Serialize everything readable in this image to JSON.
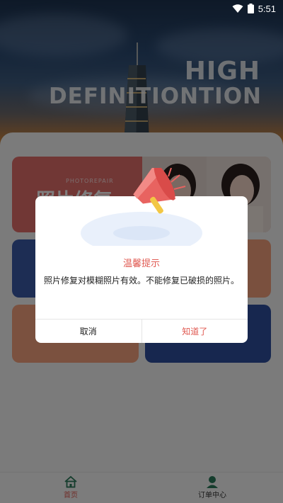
{
  "status_bar": {
    "time": "5:51",
    "icons": [
      "wifi-icon",
      "battery-icon"
    ]
  },
  "hero": {
    "title_line1": "HIGH",
    "title_line2": "DEFINITIONTION"
  },
  "cards": {
    "repair": {
      "subtitle": "PHOTOREPAIR",
      "label": "照片修复"
    }
  },
  "bottom_nav": {
    "items": [
      {
        "label": "首页",
        "icon": "home-icon",
        "active": true
      },
      {
        "label": "订单中心",
        "icon": "user-icon",
        "active": false
      }
    ]
  },
  "dialog": {
    "title": "温馨提示",
    "message": "照片修复对模糊照片有效。不能修复已破损的照片。",
    "cancel_label": "取消",
    "ok_label": "知道了",
    "icon": "megaphone-icon"
  },
  "colors": {
    "accent": "#e05a52",
    "repair_card": "#e36e6b",
    "blue_card": "#2f4f9e",
    "orange_card": "#f6a27e",
    "overlay": "rgba(0,0,0,0.5)"
  }
}
